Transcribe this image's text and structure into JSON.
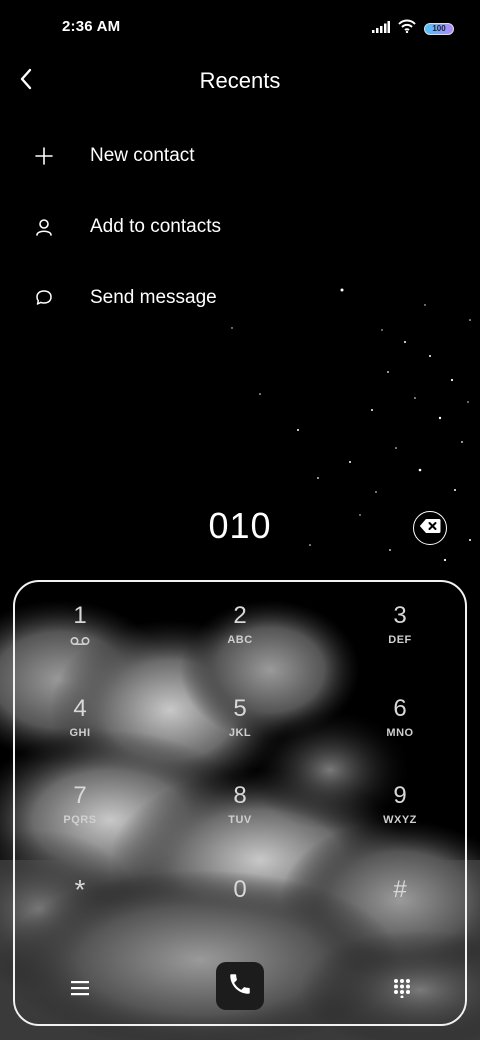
{
  "status_bar": {
    "time": "2:36 AM",
    "battery_level": "100",
    "icons": [
      "signal-icon",
      "wifi-icon",
      "battery-icon"
    ]
  },
  "header": {
    "title": "Recents",
    "back_icon": "chevron-left-icon"
  },
  "actions": [
    {
      "label": "New contact",
      "icon": "plus-icon"
    },
    {
      "label": "Add to contacts",
      "icon": "person-icon"
    },
    {
      "label": "Send message",
      "icon": "chat-bubble-icon"
    }
  ],
  "dialer": {
    "number": "010",
    "delete_icon": "backspace-icon",
    "keys": [
      {
        "digit": "1",
        "letters": "",
        "sub_icon": "voicemail-icon"
      },
      {
        "digit": "2",
        "letters": "ABC"
      },
      {
        "digit": "3",
        "letters": "DEF"
      },
      {
        "digit": "4",
        "letters": "GHI"
      },
      {
        "digit": "5",
        "letters": "JKL"
      },
      {
        "digit": "6",
        "letters": "MNO"
      },
      {
        "digit": "7",
        "letters": "PQRS"
      },
      {
        "digit": "8",
        "letters": "TUV"
      },
      {
        "digit": "9",
        "letters": "WXYZ"
      },
      {
        "digit": "*",
        "letters": ""
      },
      {
        "digit": "0",
        "letters": ""
      },
      {
        "digit": "#",
        "letters": ""
      }
    ],
    "bottom_bar": {
      "menu_icon": "hamburger-menu-icon",
      "call_icon": "phone-icon",
      "keypad_icon": "dialpad-icon"
    }
  },
  "colors": {
    "background": "#000000",
    "text": "#ffffff",
    "key_text": "#d8d8d8",
    "call_button_bg": "#1c1c1c"
  }
}
